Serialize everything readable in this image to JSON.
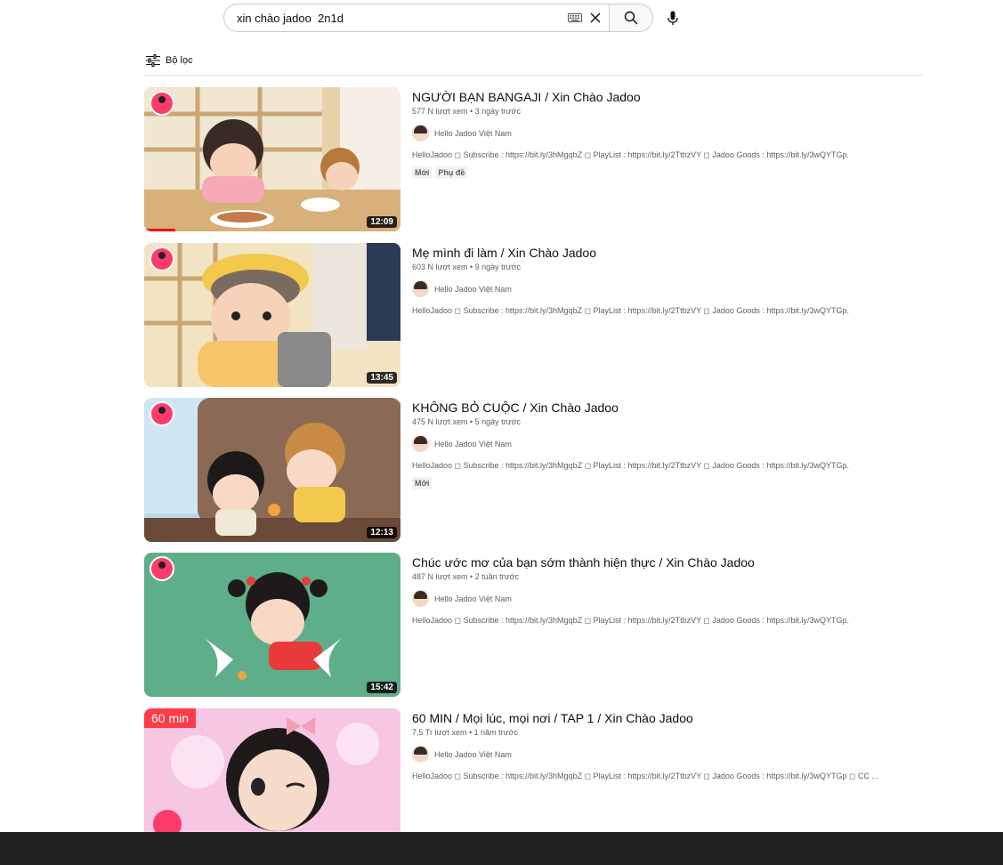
{
  "search": {
    "query": "xin chào jadoo  2n1d"
  },
  "filter": {
    "label": "Bộ lọc"
  },
  "results": [
    {
      "title": "NGƯỜI BẠN BANGAJI / Xin Chào Jadoo",
      "meta": "577 N lượt xem • 3 ngày trước",
      "channel": "Hello Jadoo Việt Nam",
      "description": "HelloJadoo ◻ Subscribe : https://bit.ly/3hMgqbZ ◻ PlayList : https://bit.ly/2TtbzVY ◻ Jadoo Goods : https://bit.ly/3wQYTGp.",
      "duration": "12:09",
      "tags": [
        "Mới",
        "Phụ đề"
      ],
      "watched": 0.12
    },
    {
      "title": "Mẹ mình đi làm / Xin Chào Jadoo",
      "meta": "603 N lượt xem • 9 ngày trước",
      "channel": "Hello Jadoo Việt Nam",
      "description": "HelloJadoo ◻ Subscribe : https://bit.ly/3hMgqbZ ◻ PlayList : https://bit.ly/2TtbzVY ◻ Jadoo Goods : https://bit.ly/3wQYTGp.",
      "duration": "13:45",
      "tags": []
    },
    {
      "title": "KHÔNG BỎ CUỘC / Xin Chào Jadoo",
      "meta": "475 N lượt xem • 5 ngày trước",
      "channel": "Hello Jadoo Việt Nam",
      "description": "HelloJadoo ◻ Subscribe : https://bit.ly/3hMgqbZ ◻ PlayList : https://bit.ly/2TtbzVY ◻ Jadoo Goods : https://bit.ly/3wQYTGp.",
      "duration": "12:13",
      "tags": [
        "Mới"
      ]
    },
    {
      "title": "Chúc ước mơ của bạn sớm thành hiện thực / Xin Chào Jadoo",
      "meta": "487 N lượt xem • 2 tuần trước",
      "channel": "Hello Jadoo Việt Nam",
      "description": "HelloJadoo ◻ Subscribe : https://bit.ly/3hMgqbZ ◻ PlayList : https://bit.ly/2TtbzVY ◻ Jadoo Goods : https://bit.ly/3wQYTGp.",
      "duration": "15:42",
      "tags": []
    },
    {
      "title": "60 MIN / Mọi lúc, mọi nơi / TAP 1 / Xin Chào Jadoo",
      "meta": "7,5 Tr lượt xem • 1 năm trước",
      "channel": "Hello Jadoo Việt Nam",
      "description": "HelloJadoo ◻ Subscribe : https://bit.ly/3hMgqbZ ◻ PlayList : https://bit.ly/2TtbzVY ◻ Jadoo Goods : https://bit.ly/3wQYTGp ◻ CC ...",
      "duration": "",
      "badge": "60 min",
      "tags": []
    }
  ],
  "colors": {
    "progress": "#ff0000",
    "badge": "#ff3b4a",
    "bottom_bar": "#222222"
  }
}
